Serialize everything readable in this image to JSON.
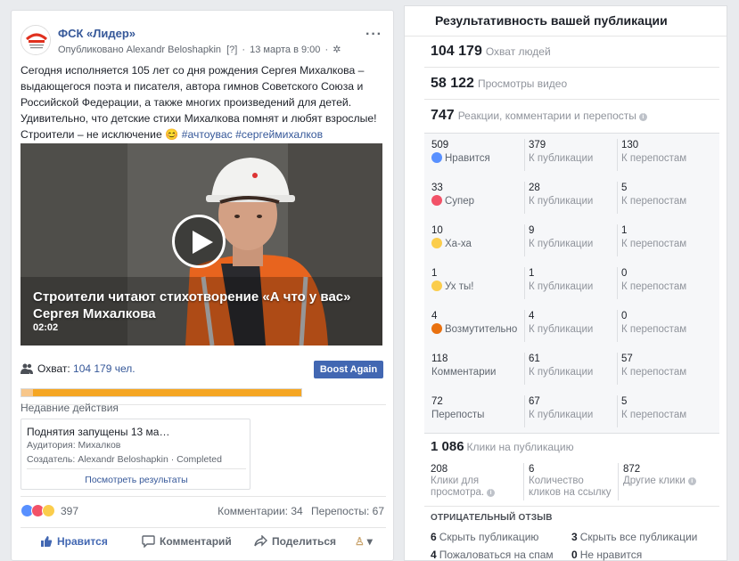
{
  "post": {
    "page_name": "ФСК «Лидер»",
    "published_by": "Опубликовано Alexandr Beloshapkin",
    "help_mark": "[?]",
    "date": "13 марта в 9:00",
    "text": "Сегодня исполняется 105 лет со дня рождения Сергея Михалкова – выдающегося поэта и писателя, автора гимнов Советского Союза и Российской Федерации, а также многих произведений для детей. Удивительно, что детские стихи Михалкова помнят и любят взрослые! Строители – не исключение 😊 ",
    "hashtags": "#ачтоувас #сергеймихалков",
    "video": {
      "title": "Строители читают стихотворение «А что у вас» Сергея Михалкова",
      "duration": "02:02"
    },
    "reach_label": "Охват:",
    "reach_value": "104 179 чел.",
    "reach_progress_pct": 4,
    "boost_label": "Boost Again",
    "recent_title": "Недавние действия",
    "recent_card": {
      "title": "Поднятия запущены 13 ма…",
      "audience": "Аудитория: Михалков",
      "creator": "Создатель: Alexandr Beloshapkin · Completed",
      "link": "Посмотреть результаты"
    },
    "reactions_count": "397",
    "comments_count": "Комментарии: 34",
    "shares_count": "Перепосты: 67",
    "actions": {
      "like": "Нравится",
      "comment": "Комментарий",
      "share": "Поделиться"
    }
  },
  "panel": {
    "title": "Результативность вашей публикации",
    "reach": {
      "value": "104 179",
      "label": "Охват людей"
    },
    "views": {
      "value": "58 122",
      "label": "Просмотры видео"
    },
    "engagement": {
      "value": "747",
      "label": "Реакции, комментарии и перепосты"
    },
    "rows": [
      {
        "c1n": "509",
        "c1l": "Нравится",
        "c2n": "379",
        "c2l": "К публикации",
        "c3n": "130",
        "c3l": "К перепостам",
        "emoji": "like"
      },
      {
        "c1n": "33",
        "c1l": "Супер",
        "c2n": "28",
        "c2l": "К публикации",
        "c3n": "5",
        "c3l": "К перепостам",
        "emoji": "love"
      },
      {
        "c1n": "10",
        "c1l": "Ха-ха",
        "c2n": "9",
        "c2l": "К публикации",
        "c3n": "1",
        "c3l": "К перепостам",
        "emoji": "haha"
      },
      {
        "c1n": "1",
        "c1l": "Ух ты!",
        "c2n": "1",
        "c2l": "К публикации",
        "c3n": "0",
        "c3l": "К перепостам",
        "emoji": "wow"
      },
      {
        "c1n": "4",
        "c1l": "Возмутительно",
        "c2n": "4",
        "c2l": "К публикации",
        "c3n": "0",
        "c3l": "К перепостам",
        "emoji": "angry"
      },
      {
        "c1n": "118",
        "c1l": "Комментарии",
        "c2n": "61",
        "c2l": "К публикации",
        "c3n": "57",
        "c3l": "К перепостам",
        "emoji": ""
      },
      {
        "c1n": "72",
        "c1l": "Перепосты",
        "c2n": "67",
        "c2l": "К публикации",
        "c3n": "5",
        "c3l": "К перепостам",
        "emoji": ""
      }
    ],
    "clicks": {
      "value": "1 086",
      "label": "Клики на публикацию"
    },
    "click_items": [
      {
        "value": "208",
        "label1": "Клики для",
        "label2": "просмотра."
      },
      {
        "value": "6",
        "label1": "Количество",
        "label2": "кликов на ссылку"
      },
      {
        "value": "872",
        "label1": "Другие клики",
        "label2": ""
      }
    ],
    "negative_title": "ОТРИЦАТЕЛЬНЫЙ ОТЗЫВ",
    "negative": [
      {
        "value": "6",
        "label": "Скрыть публикацию"
      },
      {
        "value": "3",
        "label": "Скрыть все публикации"
      },
      {
        "value": "4",
        "label": "Пожаловаться на спам"
      },
      {
        "value": "0",
        "label": "Не нравится"
      }
    ]
  },
  "colors": {
    "fb_blue": "#4267b2",
    "link": "#365899",
    "reach_bar": "#f5a623"
  }
}
